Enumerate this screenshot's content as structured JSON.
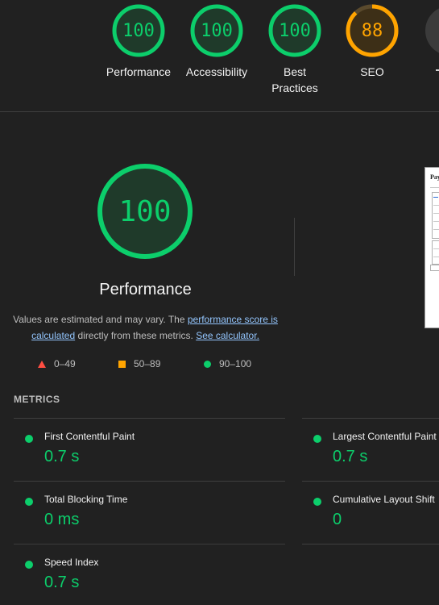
{
  "category_gauges": [
    {
      "score": "100",
      "label": "Performance",
      "color": "#0cce6b"
    },
    {
      "score": "100",
      "label": "Accessibility",
      "color": "#0cce6b"
    },
    {
      "score": "100",
      "label": "Best Practices",
      "color": "#0cce6b"
    },
    {
      "score": "88",
      "label": "SEO",
      "color": "#ffa400"
    }
  ],
  "main": {
    "score": "100",
    "title": "Performance",
    "description_prefix": "Values are estimated and may vary. The ",
    "performance_link": "performance score is calculated",
    "description_mid": " directly from these metrics. ",
    "calculator_link": "See calculator."
  },
  "legend": [
    {
      "range": "0–49",
      "shape": "triangle",
      "color": "#ff4e42"
    },
    {
      "range": "50–89",
      "shape": "square",
      "color": "#ffa400"
    },
    {
      "range": "90–100",
      "shape": "circle",
      "color": "#0cce6b"
    }
  ],
  "metrics": {
    "heading": "METRICS",
    "items": [
      {
        "name": "First Contentful Paint",
        "value": "0.7 s"
      },
      {
        "name": "Largest Contentful Paint",
        "value": "0.7 s"
      },
      {
        "name": "Total Blocking Time",
        "value": "0 ms"
      },
      {
        "name": "Cumulative Layout Shift",
        "value": "0"
      },
      {
        "name": "Speed Index",
        "value": "0.7 s"
      }
    ]
  },
  "preview": {
    "title": "Pay"
  }
}
